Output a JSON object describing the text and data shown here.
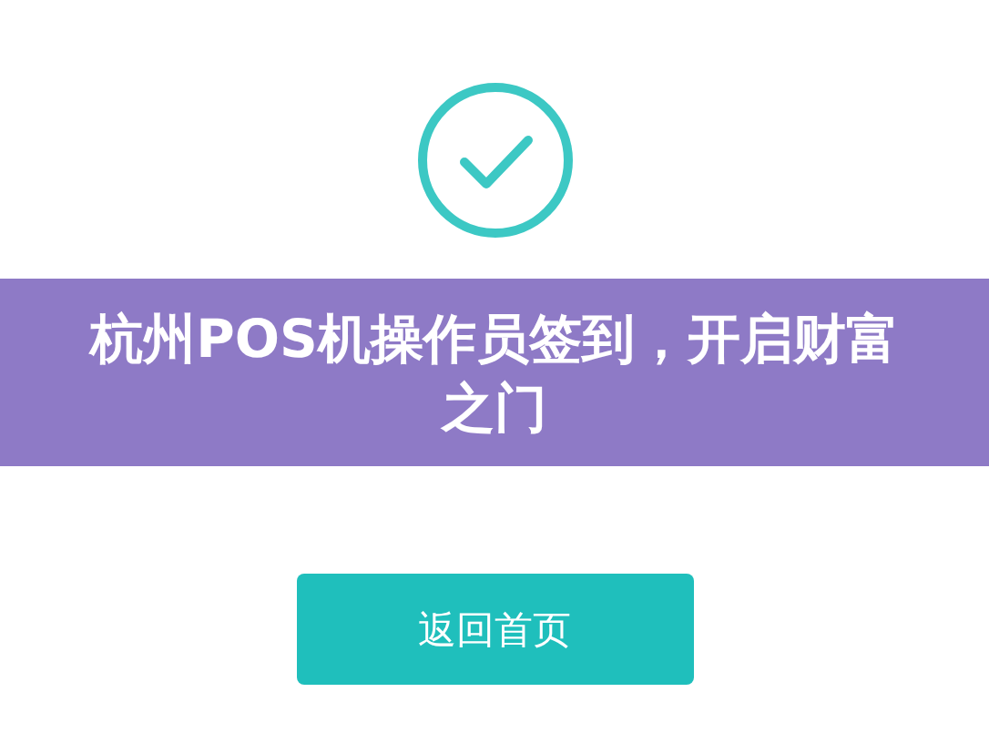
{
  "banner": {
    "title": "杭州POS机操作员签到，开启财富之门"
  },
  "button": {
    "label": "返回首页"
  }
}
